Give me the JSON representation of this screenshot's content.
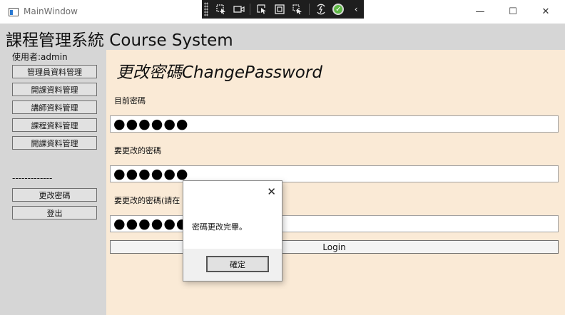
{
  "window": {
    "title": "MainWindow",
    "minimize": "—",
    "maximize": "☐",
    "close": "✕"
  },
  "debug_toolbar": {
    "tools": [
      "select-visual-icon",
      "record-icon",
      "select-element-icon",
      "display-layout-icon",
      "track-focus-icon",
      "hot-reload-icon",
      "check-icon",
      "collapse-icon"
    ],
    "collapse": "‹"
  },
  "header": {
    "title": "課程管理系統 Course System"
  },
  "sidebar": {
    "user": "使用者:admin",
    "items": [
      {
        "label": "管理員資料管理"
      },
      {
        "label": "開課資料管理"
      },
      {
        "label": "講師資料管理"
      },
      {
        "label": "課程資料管理"
      },
      {
        "label": "開課資料管理"
      }
    ],
    "separator": "-------------",
    "bottom_items": [
      {
        "label": "更改密碼"
      },
      {
        "label": "登出"
      }
    ]
  },
  "main": {
    "title": "更改密碼ChangePassword",
    "fields": [
      {
        "label": "目前密碼",
        "value": "●●●●●●"
      },
      {
        "label": "要更改的密碼",
        "value": "●●●●●●"
      },
      {
        "label": "要更改的密碼(請在",
        "value": "●●●●●●"
      }
    ],
    "login_label": "Login"
  },
  "dialog": {
    "close": "✕",
    "message": "密碼更改完畢。",
    "ok_label": "確定"
  }
}
